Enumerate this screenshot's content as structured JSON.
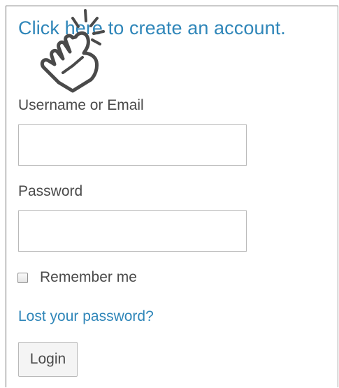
{
  "header": {
    "create_account_link": "Click here to create an account."
  },
  "overlay": {
    "icon": "pointing-hand-click-icon"
  },
  "form": {
    "username_label": "Username or Email",
    "username_value": "",
    "password_label": "Password",
    "password_value": "",
    "remember_label": "Remember me",
    "remember_checked": false,
    "lost_password_link": "Lost your password?",
    "login_button": "Login"
  },
  "colors": {
    "link": "#2f86b9",
    "text": "#4a4a4a",
    "border": "#b9b9b9"
  }
}
